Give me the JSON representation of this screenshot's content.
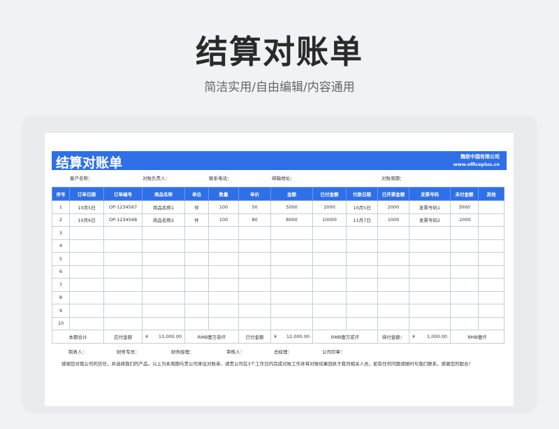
{
  "hero": {
    "title": "结算对账单",
    "subtitle": "简洁实用/自由编辑/内容通用"
  },
  "banner": {
    "title": "结算对账单",
    "company": "魏软中国有限公司",
    "website": "www.officeplus.cn"
  },
  "info": {
    "customer": "客户名称：",
    "manager": "对账负责人：",
    "phone": "联系电话：",
    "email": "邮箱地址：",
    "period": "对账周期："
  },
  "headers": [
    "序号",
    "订单日期",
    "订单编号",
    "商品名称",
    "单位",
    "数量",
    "单价",
    "金额",
    "已付金额",
    "付款日期",
    "已开票金额",
    "发票号码",
    "未付金额",
    "其他"
  ],
  "rows": [
    [
      "1",
      "10月5日",
      "OP-1234567",
      "商品名称1",
      "件",
      "100",
      "50",
      "5000",
      "2000",
      "10月5日",
      "2000",
      "发票号码1",
      "3000",
      ""
    ],
    [
      "2",
      "10月6日",
      "OP-1234568",
      "商品名称2",
      "件",
      "100",
      "80",
      "8000",
      "10000",
      "11月7日",
      "1000",
      "发票号码2",
      "-2000",
      ""
    ],
    [
      "3",
      "",
      "",
      "",
      "",
      "",
      "",
      "",
      "",
      "",
      "",
      "",
      "",
      ""
    ],
    [
      "4",
      "",
      "",
      "",
      "",
      "",
      "",
      "",
      "",
      "",
      "",
      "",
      "",
      ""
    ],
    [
      "5",
      "",
      "",
      "",
      "",
      "",
      "",
      "",
      "",
      "",
      "",
      "",
      "",
      ""
    ],
    [
      "6",
      "",
      "",
      "",
      "",
      "",
      "",
      "",
      "",
      "",
      "",
      "",
      "",
      ""
    ],
    [
      "7",
      "",
      "",
      "",
      "",
      "",
      "",
      "",
      "",
      "",
      "",
      "",
      "",
      ""
    ],
    [
      "8",
      "",
      "",
      "",
      "",
      "",
      "",
      "",
      "",
      "",
      "",
      "",
      "",
      ""
    ],
    [
      "9",
      "",
      "",
      "",
      "",
      "",
      "",
      "",
      "",
      "",
      "",
      "",
      "",
      ""
    ],
    [
      "10",
      "",
      "",
      "",
      "",
      "",
      "",
      "",
      "",
      "",
      "",
      "",
      "",
      ""
    ]
  ],
  "totals": {
    "label": "本期合计",
    "payable_label": "应付金额",
    "payable_currency": "¥",
    "payable_value": "13,000.00",
    "payable_words": "RMB壹万叁仟",
    "paid_label": "已付金额",
    "paid_currency": "¥",
    "paid_value": "12,000.00",
    "paid_words": "RMB壹万贰仟",
    "due_label": "待付金额：",
    "due_currency": "¥",
    "due_value": "1,000.00",
    "due_words": "RMB壹仟"
  },
  "signatures": {
    "maker": "制表人：",
    "finance": "财务专员：",
    "finance_mgr": "财务经理：",
    "reviewer": "审核人：",
    "gm": "总经理：",
    "seal": "公司印章："
  },
  "note": "感谢您对我公司的信任，并选择我们的产品。以上为本周期与贵公司来往对账单，请贵公司在3个工作日内完成对账工作并将对账结果回执于我司相关人员，如有任何问题请随时与我们联系，感谢您的配合！"
}
